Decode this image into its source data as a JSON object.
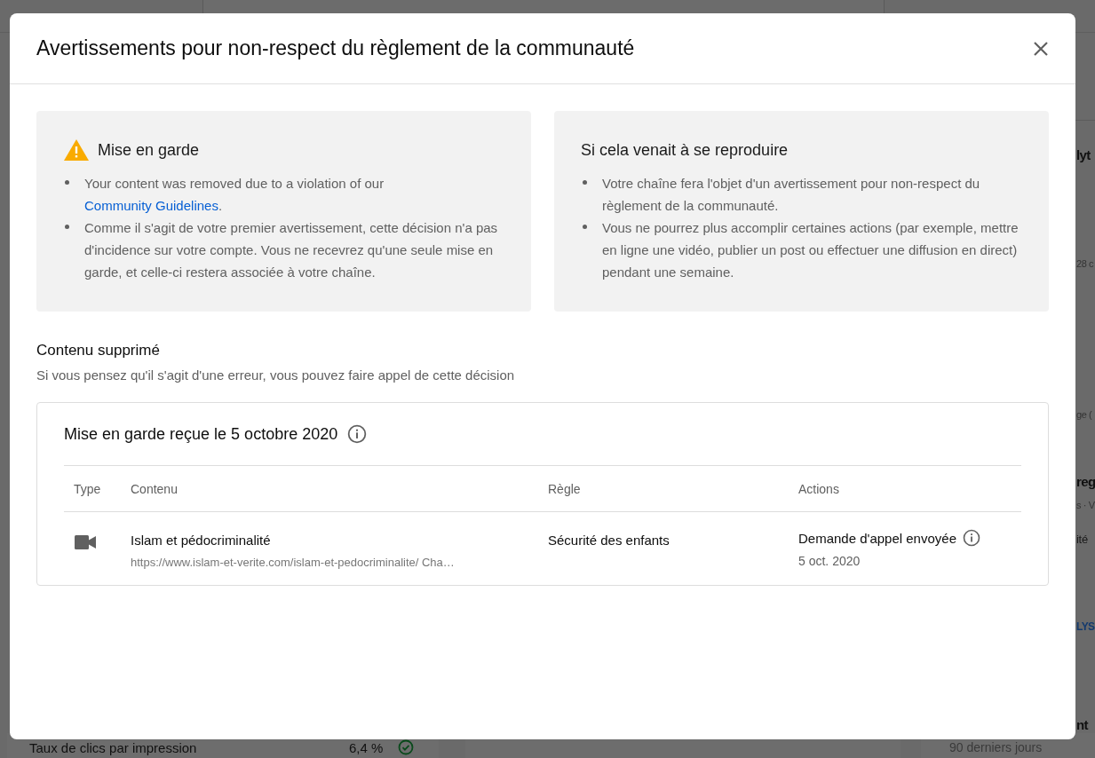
{
  "background": {
    "side_fragments": [
      {
        "text": "lyt",
        "kind": "heading"
      },
      {
        "text": "28 c",
        "kind": "meta"
      },
      {
        "text": "ge (",
        "kind": "meta"
      },
      {
        "text": "reg",
        "kind": "heading"
      },
      {
        "text": "s · V",
        "kind": "meta"
      },
      {
        "text": "ité",
        "kind": "body"
      },
      {
        "text": "LYS",
        "kind": "link"
      },
      {
        "text": "nt",
        "kind": "heading"
      }
    ],
    "metric": {
      "label": "Taux de clics par impression",
      "value": "6,4 %",
      "ok": true
    },
    "period": "90 derniers jours"
  },
  "dialog": {
    "title": "Avertissements pour non-respect du règlement de la communauté",
    "cards": [
      {
        "kind": "warning",
        "title": "Mise en garde",
        "bullets": [
          {
            "text": "Your content was removed due to a violation of our ",
            "link": "Community Guidelines",
            "after": "."
          },
          {
            "text": "Comme il s'agit de votre premier avertissement, cette décision n'a pas d'incidence sur votre compte. Vous ne recevrez qu'une seule mise en garde, et celle-ci restera associée à votre chaîne."
          }
        ]
      },
      {
        "kind": "info",
        "title": "Si cela venait à se reproduire",
        "bullets": [
          {
            "text": "Votre chaîne fera l'objet d'un avertissement pour non-respect du règlement de la communauté."
          },
          {
            "text": "Vous ne pourrez plus accomplir certaines actions (par exemple, mettre en ligne une vidéo, publier un post ou effectuer une diffusion en direct) pendant une semaine."
          }
        ]
      }
    ],
    "section": {
      "title": "Contenu supprimé",
      "subtitle": "Si vous pensez qu'il s'agit d'une erreur, vous pouvez faire appel de cette décision"
    },
    "strike": {
      "title": "Mise en garde reçue le 5 octobre 2020",
      "table": {
        "columns": [
          "Type",
          "Contenu",
          "Règle",
          "Actions"
        ],
        "rows": [
          {
            "kind": "video",
            "title": "Islam et pédocriminalité",
            "url": "https://www.islam-et-verite.com/islam-et-pedocriminalite/ Cha…",
            "rule": "Sécurité des enfants",
            "action": "Demande d'appel envoyée",
            "date": "5 oct. 2020"
          }
        ]
      }
    }
  }
}
